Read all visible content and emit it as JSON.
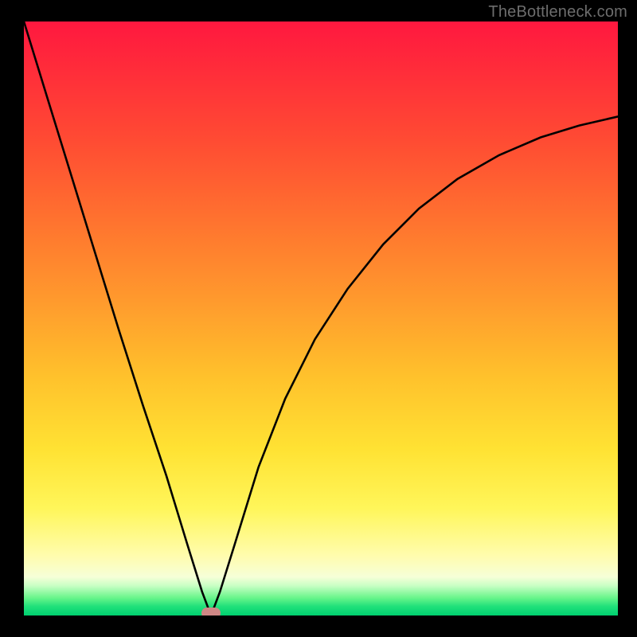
{
  "watermark": "TheBottleneck.com",
  "chart_data": {
    "type": "line",
    "title": "",
    "xlabel": "",
    "ylabel": "",
    "xlim": [
      0,
      1
    ],
    "ylim": [
      0,
      1
    ],
    "note": "Axes unlabeled; values are normalized fractions of the plot area. Curve is a V-shaped dip reaching ~0 at x≈0.315.",
    "series": [
      {
        "name": "bottleneck-curve",
        "x": [
          0.0,
          0.04,
          0.08,
          0.12,
          0.16,
          0.2,
          0.24,
          0.275,
          0.3,
          0.315,
          0.33,
          0.355,
          0.395,
          0.44,
          0.49,
          0.545,
          0.605,
          0.665,
          0.73,
          0.8,
          0.87,
          0.935,
          1.0
        ],
        "y": [
          1.0,
          0.87,
          0.74,
          0.61,
          0.48,
          0.355,
          0.235,
          0.12,
          0.04,
          0.0,
          0.04,
          0.12,
          0.25,
          0.365,
          0.465,
          0.55,
          0.625,
          0.685,
          0.735,
          0.775,
          0.805,
          0.825,
          0.84
        ]
      }
    ],
    "marker": {
      "x": 0.315,
      "y": 0.004,
      "color": "#cf8785"
    },
    "background_gradient_stops": [
      {
        "pos": 0.0,
        "color": "#ff183f"
      },
      {
        "pos": 0.47,
        "color": "#ff9a2d"
      },
      {
        "pos": 0.82,
        "color": "#fff65a"
      },
      {
        "pos": 0.95,
        "color": "#c8ffc4"
      },
      {
        "pos": 1.0,
        "color": "#00d070"
      }
    ]
  }
}
